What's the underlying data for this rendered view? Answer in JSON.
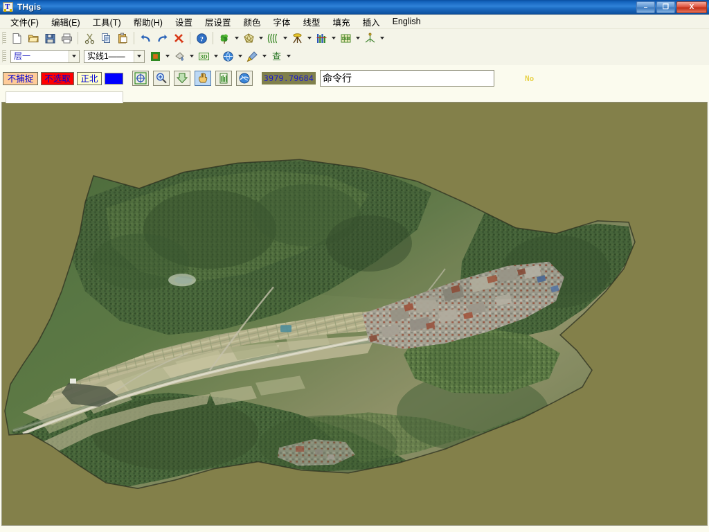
{
  "window": {
    "title": "THgis",
    "icon": "thgis-app-icon",
    "controls": {
      "minimize_label": "–",
      "restore_label": "❐",
      "close_label": "X"
    }
  },
  "menubar": {
    "items": [
      {
        "label": "文件(F)",
        "name": "menu-file"
      },
      {
        "label": "编辑(E)",
        "name": "menu-edit"
      },
      {
        "label": "工具(T)",
        "name": "menu-tools"
      },
      {
        "label": "帮助(H)",
        "name": "menu-help"
      },
      {
        "label": "设置",
        "name": "menu-settings"
      },
      {
        "label": "层设置",
        "name": "menu-layer-settings"
      },
      {
        "label": "颜色",
        "name": "menu-color"
      },
      {
        "label": "字体",
        "name": "menu-font"
      },
      {
        "label": "线型",
        "name": "menu-linetype"
      },
      {
        "label": "填充",
        "name": "menu-fill"
      },
      {
        "label": "插入",
        "name": "menu-insert"
      },
      {
        "label": "English",
        "name": "menu-english"
      }
    ]
  },
  "toolbar_main": {
    "buttons": [
      {
        "name": "new-file-icon",
        "glyph": "new-document"
      },
      {
        "name": "open-file-icon",
        "glyph": "open-folder"
      },
      {
        "name": "save-file-icon",
        "glyph": "floppy-disk"
      },
      {
        "name": "print-icon",
        "glyph": "printer"
      },
      {
        "name": "cut-icon",
        "glyph": "scissors"
      },
      {
        "name": "copy-icon",
        "glyph": "copy-pages"
      },
      {
        "name": "paste-icon",
        "glyph": "clipboard"
      },
      {
        "name": "undo-icon",
        "glyph": "undo-arrow"
      },
      {
        "name": "redo-icon",
        "glyph": "redo-arrow"
      },
      {
        "name": "delete-icon",
        "glyph": "red-x-arrow"
      },
      {
        "name": "help-icon",
        "glyph": "question-circle"
      },
      {
        "name": "vegetation-icon",
        "glyph": "green-tree",
        "dropdown": true
      },
      {
        "name": "tin-mesh-icon",
        "glyph": "triangulated-net",
        "dropdown": true
      },
      {
        "name": "contour-icon",
        "glyph": "contour-lines",
        "dropdown": true
      },
      {
        "name": "survey-instrument-icon",
        "glyph": "theodolite",
        "dropdown": true
      },
      {
        "name": "cross-section-icon",
        "glyph": "section-bars",
        "dropdown": true
      },
      {
        "name": "dem-grid-icon",
        "glyph": "green-grid",
        "dropdown": true
      },
      {
        "name": "axes-icon",
        "glyph": "coordinate-axes",
        "dropdown": true
      }
    ]
  },
  "toolbar_second": {
    "layer_combo": {
      "value": "层一",
      "name": "layer-combo"
    },
    "linetype_combo": {
      "value": "实线1——",
      "name": "linetype-combo"
    },
    "buttons": [
      {
        "name": "fill-style-icon",
        "glyph": "filled-square",
        "dropdown": true
      },
      {
        "name": "pour-fill-icon",
        "glyph": "paint-pour",
        "dropdown": true
      },
      {
        "name": "three-d-icon",
        "glyph": "3d-text",
        "dropdown": true
      },
      {
        "name": "globe-icon",
        "glyph": "blue-globe",
        "dropdown": true
      },
      {
        "name": "brush-icon",
        "glyph": "paint-brush",
        "dropdown": true
      },
      {
        "name": "query-icon",
        "glyph": "cha-character",
        "dropdown": true
      }
    ]
  },
  "status_strip": {
    "snap_flag": "不捕捉",
    "select_flag": "不选取",
    "north_flag": "正北",
    "color_swatch": "#0000ff",
    "buttons": [
      {
        "name": "zoom-extent-icon",
        "glyph": "crosshair-circle",
        "active": false
      },
      {
        "name": "zoom-in-icon",
        "glyph": "magnifier-plus",
        "active": false
      },
      {
        "name": "zoom-out-icon",
        "glyph": "down-arrow",
        "active": false
      },
      {
        "name": "pan-hand-icon",
        "glyph": "pan-hand",
        "active": true
      },
      {
        "name": "refresh-icon",
        "glyph": "green-refresh",
        "active": false
      },
      {
        "name": "earth-view-icon",
        "glyph": "earth-swoosh",
        "active": false
      }
    ],
    "coordinate": "3979.79684",
    "command_line": {
      "value": "命令行",
      "placeholder": "命令行",
      "name": "command-line-input"
    },
    "note": "No"
  },
  "map": {
    "canvas_background": "#83804a",
    "layer_name": "orthophoto-aerial-terrain",
    "description": "航空正射影像 - 山谷村落",
    "colors": {
      "forest_dark": "#3c5a33",
      "forest_mid": "#55703f",
      "forest_light": "#6b8450",
      "field_pale": "#bdbb9a",
      "field_tan": "#cfc9a6",
      "village_grey": "#9a958c",
      "roof_red": "#a05a46",
      "road_light": "#d6d2bf",
      "water_teal": "#5f8f90"
    }
  }
}
